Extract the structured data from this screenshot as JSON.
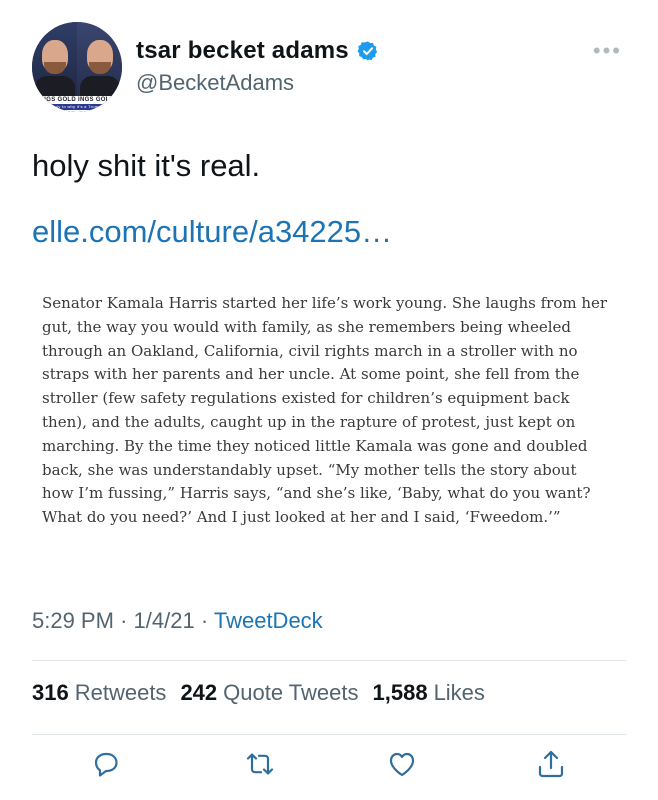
{
  "author": {
    "display_name": "tsar becket adams",
    "handle": "@BecketAdams",
    "avatar_banner": "IGS GOLD  INGS GOL",
    "avatar_banner_sub": "ready to why it's a Trump o"
  },
  "tweet": {
    "text": "holy shit it's real.",
    "link_text": "elle.com/culture/a34225…",
    "article_text": "Senator Kamala Harris started her life’s work young. She laughs from her gut, the way you would with family, as she remembers being wheeled through an Oakland, California, civil rights march in a stroller with no straps with her parents and her uncle. At some point, she fell from the stroller (few safety regulations existed for children’s equipment back then), and the adults, caught up in the rapture of protest, just kept on marching. By the time they noticed little Kamala was gone and doubled back, she was understandably upset. “My mother tells the story about how I’m fussing,” Harris says, “and she’s like, ‘Baby, what do you want? What do you need?’ And I just looked at her and I said, ‘Fweedom.’”",
    "time": "5:29 PM",
    "date": "1/4/21",
    "source": "TweetDeck",
    "separator": "·"
  },
  "stats": {
    "retweets_count": "316",
    "retweets_label": "Retweets",
    "quotes_count": "242",
    "quotes_label": "Quote Tweets",
    "likes_count": "1,588",
    "likes_label": "Likes"
  },
  "more_label": "•••",
  "colors": {
    "link": "#1d74b5",
    "verified": "#1d9bf0",
    "secondary_text": "#536471",
    "icon": "#2f6f9f"
  }
}
